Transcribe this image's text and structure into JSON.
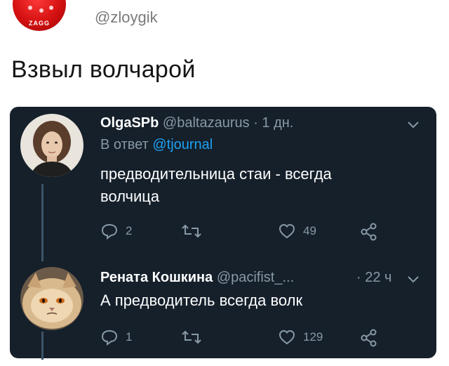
{
  "header": {
    "logo_text": "ZAGG",
    "handle": "@zloygik"
  },
  "post": {
    "text": "Взвыл волчарой"
  },
  "colors": {
    "card_bg": "#15202b",
    "muted": "#8899a6",
    "accent": "#1da1f2"
  },
  "tweets": [
    {
      "name": "OlgaSPb",
      "handle": "@baltazaurus",
      "time": "· 1 дн.",
      "reply_prefix": "В ответ",
      "reply_mention": "@tjournal",
      "text": "предводительница стаи - всегда волчица",
      "replies": "2",
      "retweets": "",
      "likes": "49",
      "icons": [
        "reply-icon",
        "retweet-icon",
        "like-icon",
        "share-icon",
        "chevron-down-icon"
      ]
    },
    {
      "name": "Рената Кошкина",
      "handle": "@pacifist_...",
      "time": "· 22 ч",
      "text": "А предводитель всегда волк",
      "replies": "1",
      "retweets": "",
      "likes": "129",
      "icons": [
        "reply-icon",
        "retweet-icon",
        "like-icon",
        "share-icon",
        "chevron-down-icon"
      ]
    }
  ]
}
